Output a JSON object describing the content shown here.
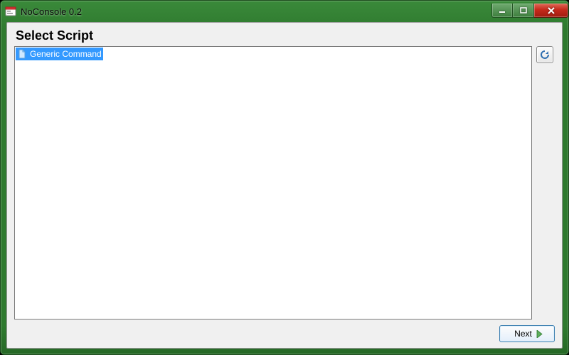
{
  "window": {
    "title": "NoConsole 0.2"
  },
  "page": {
    "heading": "Select Script"
  },
  "scripts": {
    "items": [
      {
        "label": "Generic Command"
      }
    ]
  },
  "buttons": {
    "next": "Next"
  }
}
